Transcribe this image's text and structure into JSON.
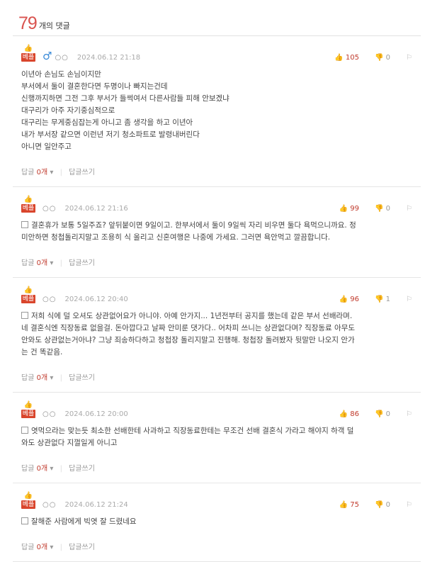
{
  "header": {
    "count": "79",
    "label": "개의 댓글"
  },
  "comments": [
    {
      "best_label": "베플",
      "nick": "○○",
      "date": "2024.06.12 21:18",
      "likes": "105",
      "dislikes": "0",
      "lines": [
        "이년아 손님도 손님이지만",
        "부서에서 둘이 결혼한다면 두명이나 빠지는건데",
        "신행까지하면 그전 그후 부서가 들썩여서 다른사람들 피해 안보겠냐",
        "대구리가 아주 자기중심적으로",
        "대구리는 무게중심잡는게 아니고 좀 생각을 하고 이년아",
        "내가 부서장 같으면 이런년 저기 청소파트로 발령내버린다",
        "아니면 일안주고"
      ],
      "reply_label": "답글",
      "reply_count": "0개",
      "write_label": "답글쓰기"
    },
    {
      "best_label": "베플",
      "nick": "○○",
      "date": "2024.06.12 21:16",
      "likes": "99",
      "dislikes": "0",
      "lines": [
        "결혼휴가 보통 5일주죠? 앞뒤붙이면 9일이고. 한부서에서 둘이 9일씩 자리 비우면 둘다 욕먹으니까요. 정",
        "미안하면 청첩돌리지말고 조용히 식 올리고 신혼여행은 나중에 가세요. 그러면 욕안먹고 깔끔합니다."
      ],
      "reply_label": "답글",
      "reply_count": "0개",
      "write_label": "답글쓰기"
    },
    {
      "best_label": "베플",
      "nick": "○○",
      "date": "2024.06.12 20:40",
      "likes": "96",
      "dislikes": "1",
      "lines": [
        "저희 식에 덜 오셔도 상관없어요가 아니야. 아예 안가지... 1년전부터 공지를 했는데 같은 부서 선배라며.",
        "네 결혼식엔 직장동료 없을걸. 돈아깝다고 날짜 안미룬 댓가다.. 어차피 쓰니는 상관없다며? 직장동료 아무도",
        "안와도 상관없는거아냐? 그냥 죄송하다하고 청첩장 돌리지말고 진행해. 청첩장 돌려봤자 뒷말만 나오지 안가",
        "는 건 똑같음."
      ],
      "reply_label": "답글",
      "reply_count": "0개",
      "write_label": "답글쓰기"
    },
    {
      "best_label": "베플",
      "nick": "○○",
      "date": "2024.06.12 20:00",
      "likes": "86",
      "dislikes": "0",
      "lines": [
        "엿먹으라는 맞는듯 최소한 선배한테 사과하고 직장동료한테는 무조건 선배 결혼식 가라고 해야지 하객 덜",
        "와도 상관없다 지껄일게 아니고"
      ],
      "reply_label": "답글",
      "reply_count": "0개",
      "write_label": "답글쓰기"
    },
    {
      "best_label": "베플",
      "nick": "○○",
      "date": "2024.06.12 21:24",
      "likes": "75",
      "dislikes": "0",
      "lines": [
        "잘해준 사람에게 빅엿 잘 드렸네요"
      ],
      "reply_label": "답글",
      "reply_count": "0개",
      "write_label": "답글쓰기"
    }
  ],
  "icons": {
    "thumb": "thumbs-up-icon",
    "male": "male-icon",
    "report": "report-icon",
    "box": "comment-box-icon",
    "dropdown": "caret-down-icon"
  },
  "colors": {
    "accent": "#d9534f",
    "best_tag": "#d9452c",
    "male": "#3a8ad8"
  }
}
